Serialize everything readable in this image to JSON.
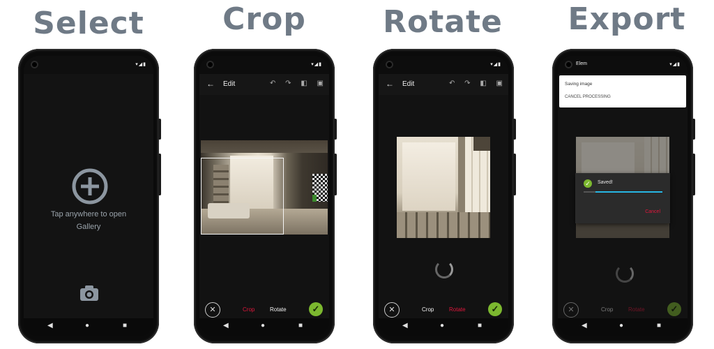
{
  "headings": [
    "Select",
    "Crop",
    "Rotate",
    "Export"
  ],
  "status_icons": "▾◢▮",
  "select_screen": {
    "prompt_line1": "Tap anywhere to open",
    "prompt_line2": "Gallery",
    "add_icon": "plus-circle-icon",
    "camera_icon": "camera-icon"
  },
  "editor": {
    "title": "Edit",
    "back_glyph": "←",
    "undo_glyph": "↶",
    "redo_glyph": "↷",
    "compare_glyph": "◧",
    "save_glyph": "▣",
    "cancel_glyph": "✕",
    "confirm_glyph": "✓",
    "tab_crop": "Crop",
    "tab_rotate": "Rotate"
  },
  "export_screen": {
    "status_text": "Elem",
    "saving_title": "Saving image",
    "cancel_processing": "CANCEL PROCESSING",
    "saved_text": "Saved!",
    "cancel_link": "Cancel",
    "progress": 0.85
  },
  "nav": {
    "back": "◀",
    "home": "●",
    "recents": "■"
  },
  "colors": {
    "accent_red": "#e0163c",
    "confirm_green": "#7cb82f",
    "progress_cyan": "#27b6e3",
    "heading": "#6f7a86"
  }
}
